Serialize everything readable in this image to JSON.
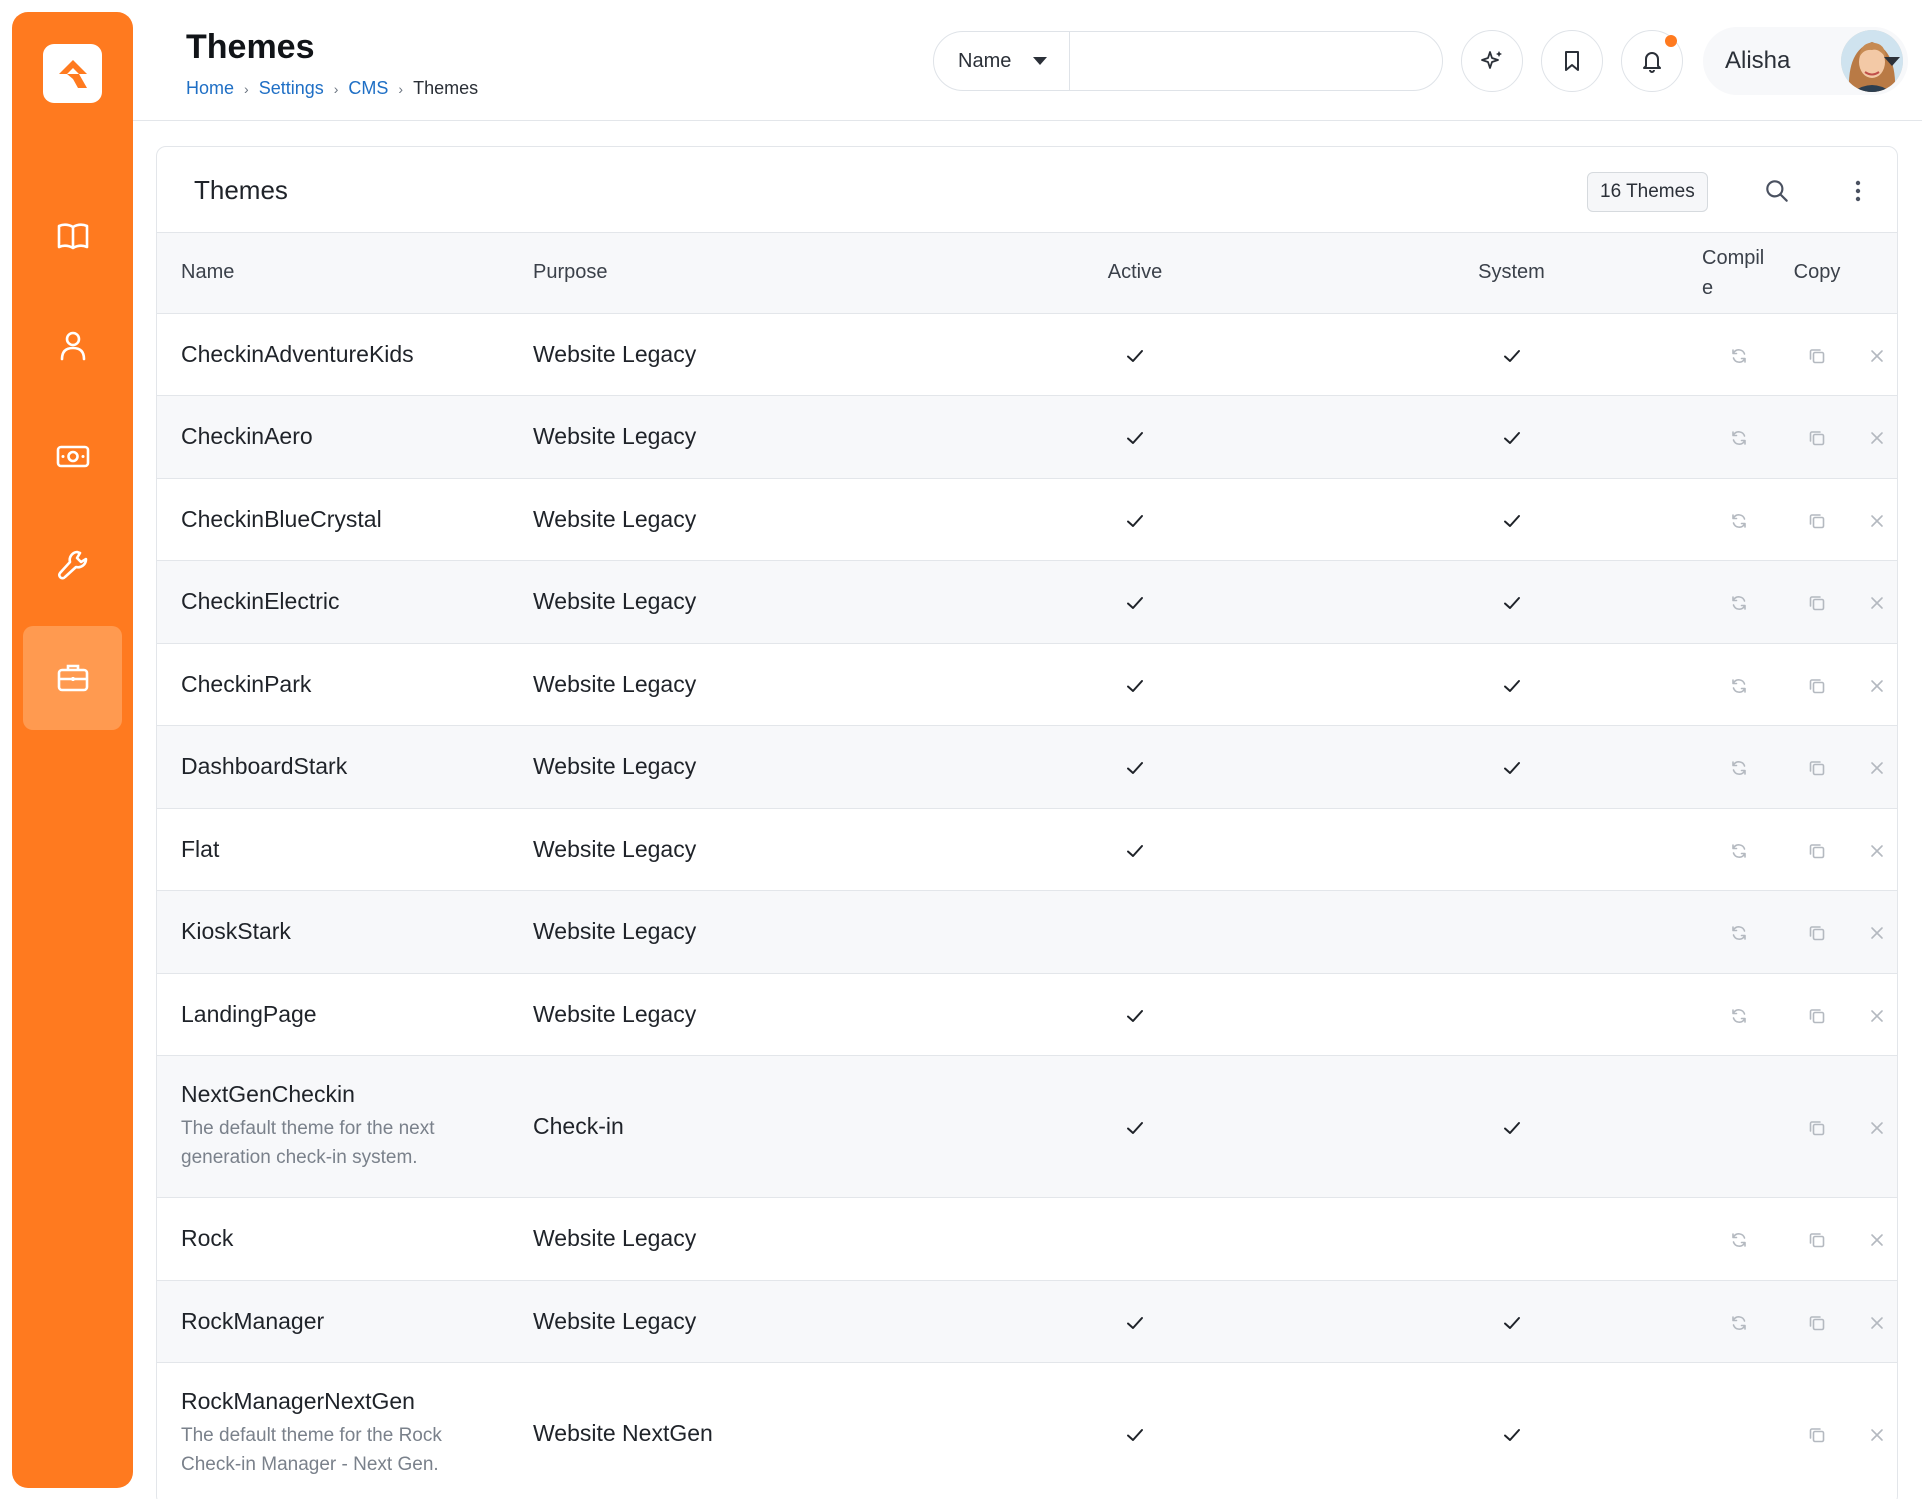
{
  "header": {
    "title": "Themes",
    "breadcrumb": [
      "Home",
      "Settings",
      "CMS",
      "Themes"
    ],
    "search_select": "Name",
    "search_placeholder": "",
    "user_name": "Alisha"
  },
  "sidebar": {
    "items": [
      {
        "icon": "book-icon"
      },
      {
        "icon": "person-icon"
      },
      {
        "icon": "money-icon"
      },
      {
        "icon": "wrench-icon"
      },
      {
        "icon": "briefcase-icon",
        "active": true
      }
    ]
  },
  "panel": {
    "title": "Themes",
    "count_badge": "16 Themes"
  },
  "table": {
    "columns": {
      "name": "Name",
      "purpose": "Purpose",
      "active": "Active",
      "system": "System",
      "compile": "Compil e",
      "copy": "Copy"
    },
    "rows": [
      {
        "name": "CheckinAdventureKids",
        "description": "",
        "purpose": "Website Legacy",
        "active": true,
        "system": true,
        "compile": true
      },
      {
        "name": "CheckinAero",
        "description": "",
        "purpose": "Website Legacy",
        "active": true,
        "system": true,
        "compile": true
      },
      {
        "name": "CheckinBlueCrystal",
        "description": "",
        "purpose": "Website Legacy",
        "active": true,
        "system": true,
        "compile": true
      },
      {
        "name": "CheckinElectric",
        "description": "",
        "purpose": "Website Legacy",
        "active": true,
        "system": true,
        "compile": true
      },
      {
        "name": "CheckinPark",
        "description": "",
        "purpose": "Website Legacy",
        "active": true,
        "system": true,
        "compile": true
      },
      {
        "name": "DashboardStark",
        "description": "",
        "purpose": "Website Legacy",
        "active": true,
        "system": true,
        "compile": true
      },
      {
        "name": "Flat",
        "description": "",
        "purpose": "Website Legacy",
        "active": true,
        "system": false,
        "compile": true
      },
      {
        "name": "KioskStark",
        "description": "",
        "purpose": "Website Legacy",
        "active": false,
        "system": false,
        "compile": true
      },
      {
        "name": "LandingPage",
        "description": "",
        "purpose": "Website Legacy",
        "active": true,
        "system": false,
        "compile": true
      },
      {
        "name": "NextGenCheckin",
        "description": "The default theme for the next generation check-in system.",
        "purpose": "Check-in",
        "active": true,
        "system": true,
        "compile": false
      },
      {
        "name": "Rock",
        "description": "",
        "purpose": "Website Legacy",
        "active": false,
        "system": false,
        "compile": true
      },
      {
        "name": "RockManager",
        "description": "",
        "purpose": "Website Legacy",
        "active": true,
        "system": true,
        "compile": true
      },
      {
        "name": "RockManagerNextGen",
        "description": "The default theme for the Rock Check-in Manager - Next Gen.",
        "purpose": "Website NextGen",
        "active": true,
        "system": true,
        "compile": false
      }
    ]
  },
  "colors": {
    "brand": "#ff7a1f",
    "link": "#1f6fc5",
    "muted_icon": "#b4b9c0"
  }
}
